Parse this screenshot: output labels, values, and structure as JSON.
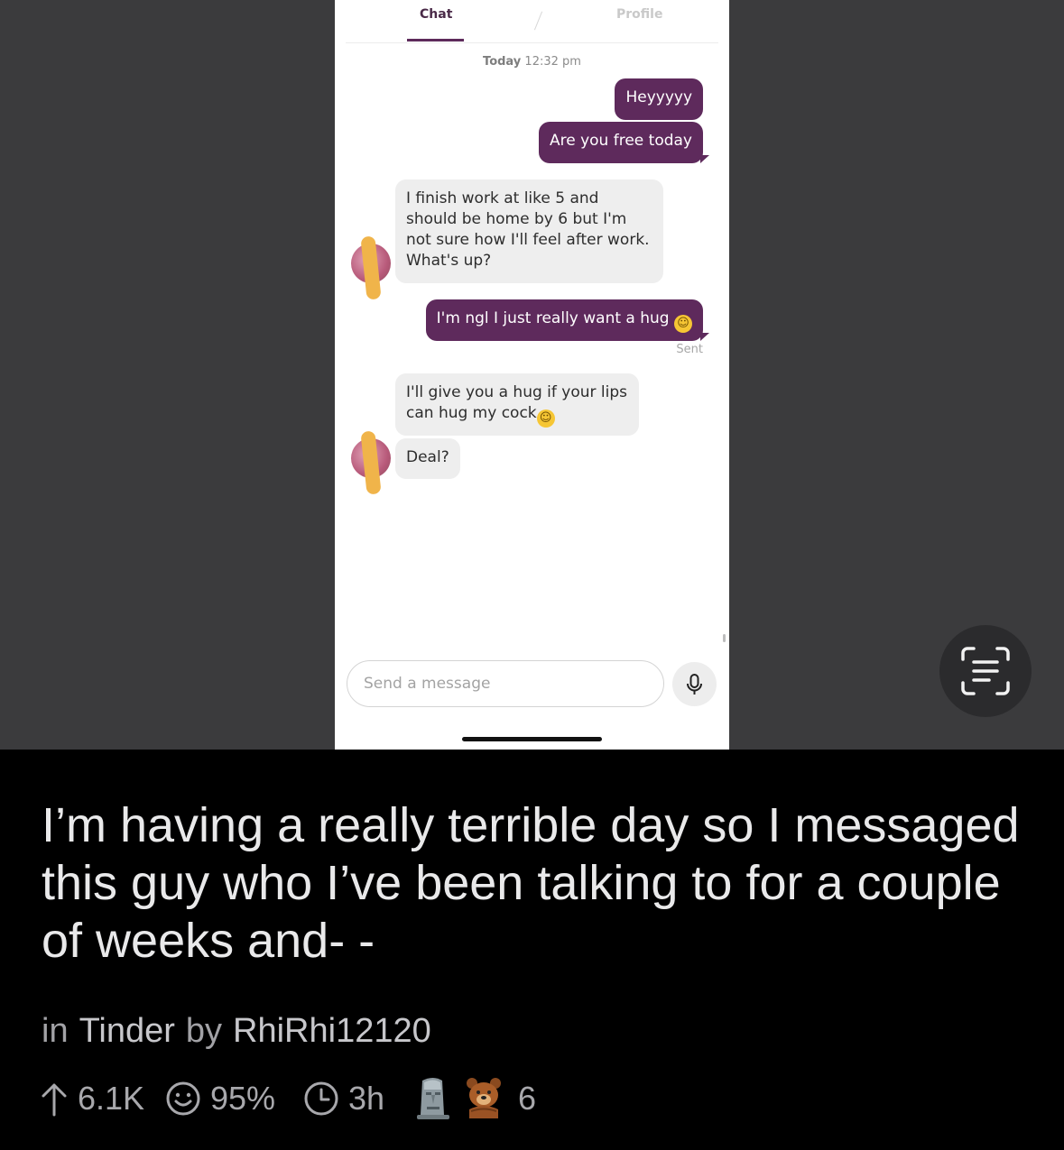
{
  "app": {
    "tabs": [
      {
        "label": "Chat",
        "active": true
      },
      {
        "label": "Profile",
        "active": false
      }
    ],
    "timestamp": {
      "day": "Today",
      "time": "12:32 pm"
    },
    "messages": [
      {
        "from": "me",
        "text": "Heyyyyy"
      },
      {
        "from": "me",
        "text": "Are you free today"
      },
      {
        "from": "them",
        "text": "I finish work at like 5 and should be home by 6 but I'm not sure how I'll feel after work. What's up?"
      },
      {
        "from": "me",
        "text": "I'm ngl I just really want a hug"
      },
      {
        "from": "them",
        "text": "I'll give you a hug if your lips can hug my cock"
      },
      {
        "from": "them",
        "text": "Deal?"
      }
    ],
    "status": "Sent",
    "composer": {
      "placeholder": "Send a message"
    },
    "accent_color": "#5e2a5c"
  },
  "post": {
    "title": "I’m having a really terrible day so I messaged this guy who I’ve been talking to for a couple of weeks and- -",
    "in_label": "in",
    "subreddit": "Tinder",
    "by_label": "by",
    "author": "RhiRhi12120",
    "upvotes": "6.1K",
    "upvote_ratio": "95%",
    "age": "3h",
    "award_count": "6"
  },
  "icons": [
    "mic-icon",
    "live-text-icon",
    "upvote-arrow-icon",
    "smiley-icon",
    "clock-icon",
    "moai-award-icon",
    "bear-award-icon"
  ]
}
